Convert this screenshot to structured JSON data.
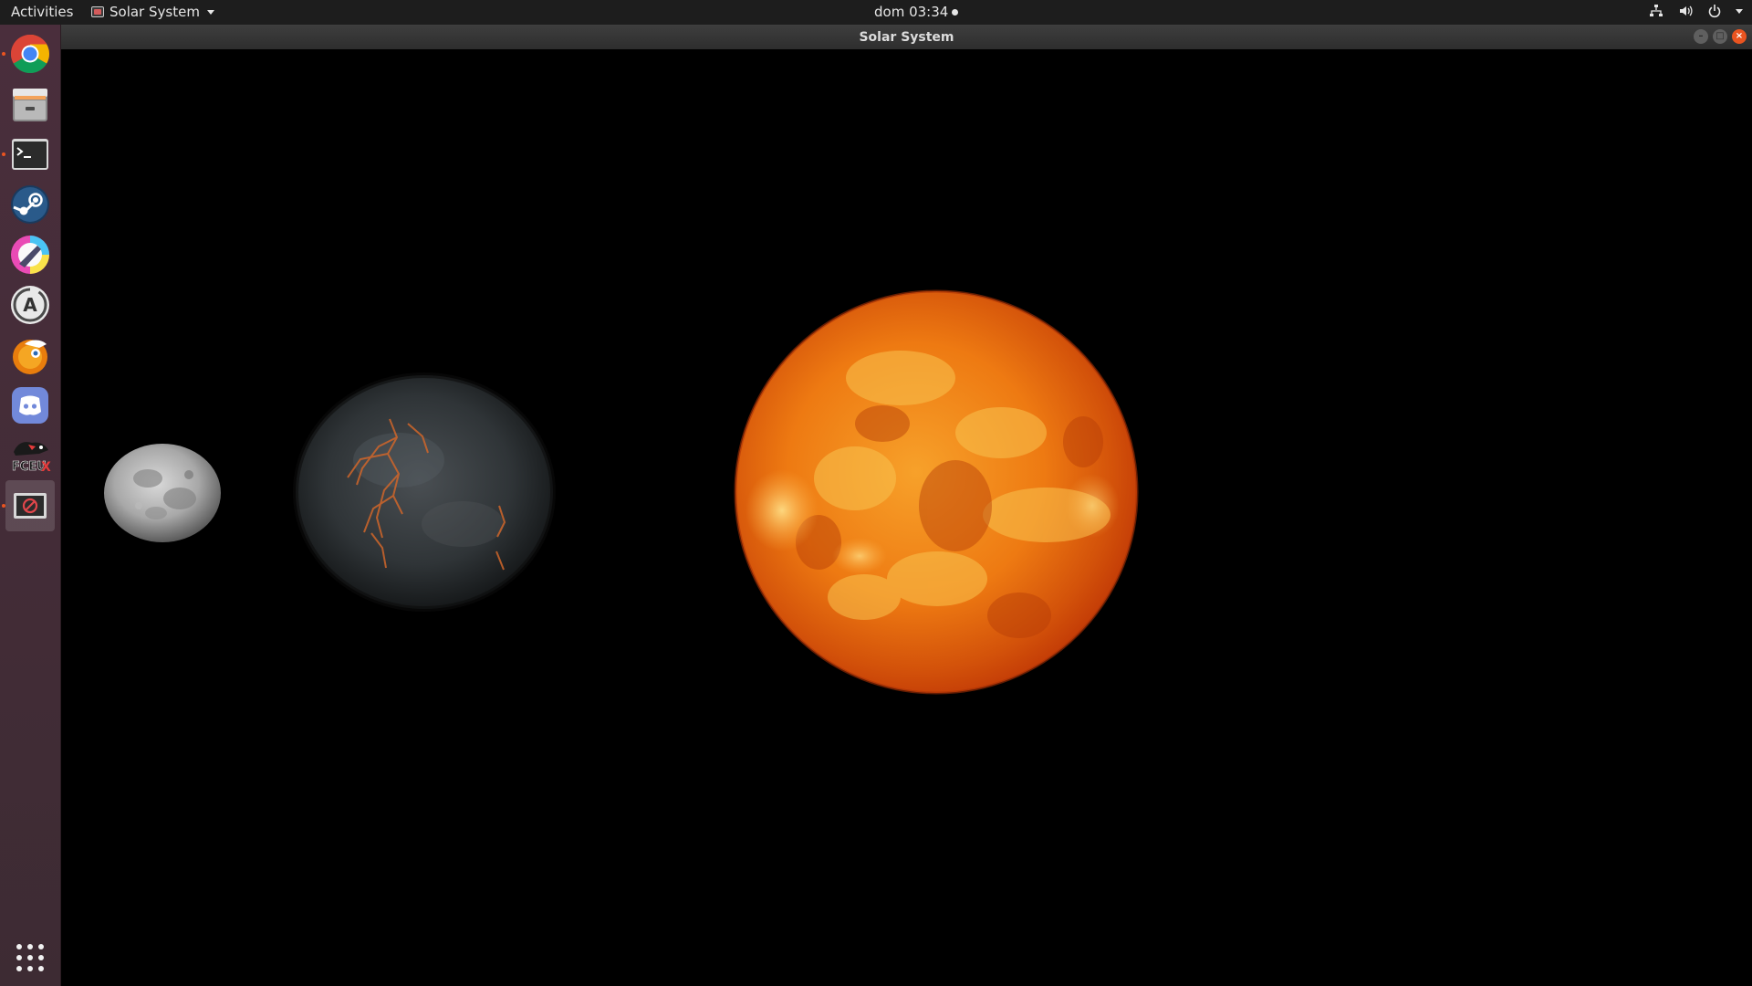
{
  "topbar": {
    "activities_label": "Activities",
    "app_menu_label": "Solar System",
    "clock": "dom 03:34"
  },
  "dock": {
    "items": [
      {
        "name": "chrome",
        "running": true
      },
      {
        "name": "files",
        "running": false
      },
      {
        "name": "terminal",
        "running": true
      },
      {
        "name": "steam",
        "running": false
      },
      {
        "name": "krita",
        "running": false
      },
      {
        "name": "software-updater",
        "running": false
      },
      {
        "name": "blender",
        "running": false
      },
      {
        "name": "discord",
        "running": false
      },
      {
        "name": "fceux",
        "running": false,
        "label": "FCEUX"
      },
      {
        "name": "solar-system-app",
        "running": true,
        "active": true
      }
    ]
  },
  "window": {
    "title": "Solar System"
  },
  "scene": {
    "bodies": [
      "moon",
      "dark-planet",
      "sun"
    ]
  },
  "colors": {
    "topbar_bg": "#1d1d1d",
    "dock_bg": "#4a2e3c",
    "accent": "#e95420",
    "sun_core": "#f7a12a",
    "sun_edge": "#c23a06"
  }
}
